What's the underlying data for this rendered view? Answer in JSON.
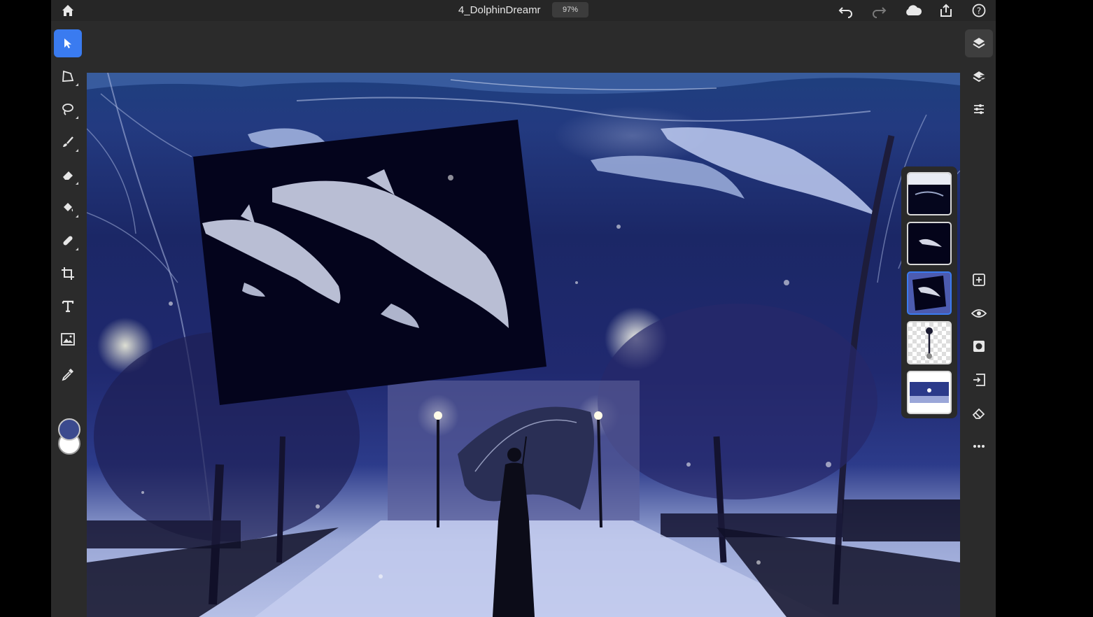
{
  "document": {
    "title": "4_DolphinDreamr",
    "zoom": "97%"
  },
  "topbar_icons": [
    "home-icon",
    "undo-icon",
    "redo-icon",
    "cloud-icon",
    "share-icon",
    "help-icon"
  ],
  "tools": [
    {
      "name": "select-tool",
      "icon": "arrow-cursor-icon",
      "active": true
    },
    {
      "name": "transform-tool",
      "icon": "transform-icon"
    },
    {
      "name": "lasso-tool",
      "icon": "lasso-icon"
    },
    {
      "name": "brush-tool",
      "icon": "brush-icon"
    },
    {
      "name": "eraser-tool",
      "icon": "eraser-icon"
    },
    {
      "name": "fill-tool",
      "icon": "paint-bucket-icon"
    },
    {
      "name": "healing-tool",
      "icon": "healing-icon"
    },
    {
      "name": "crop-tool",
      "icon": "crop-icon"
    },
    {
      "name": "type-tool",
      "icon": "type-icon"
    },
    {
      "name": "place-image-tool",
      "icon": "image-icon"
    },
    {
      "name": "eyedropper-tool",
      "icon": "eyedropper-icon"
    }
  ],
  "colors": {
    "foreground": "#3b4a8e",
    "background": "#ffffff",
    "accent": "#3a7bf0"
  },
  "right_panel": [
    "layers-icon",
    "layer-properties-icon",
    "adjustments-icon",
    "add-layer-icon",
    "visibility-icon",
    "mask-icon",
    "arrange-icon",
    "clear-icon",
    "more-icon"
  ],
  "layers": [
    {
      "name": "layer-underwater-top",
      "selected": false
    },
    {
      "name": "layer-dolphin-dark",
      "selected": false
    },
    {
      "name": "layer-dolphins-tilted",
      "selected": true
    },
    {
      "name": "layer-streetlamp",
      "selected": false
    },
    {
      "name": "layer-night-street",
      "selected": false
    }
  ]
}
